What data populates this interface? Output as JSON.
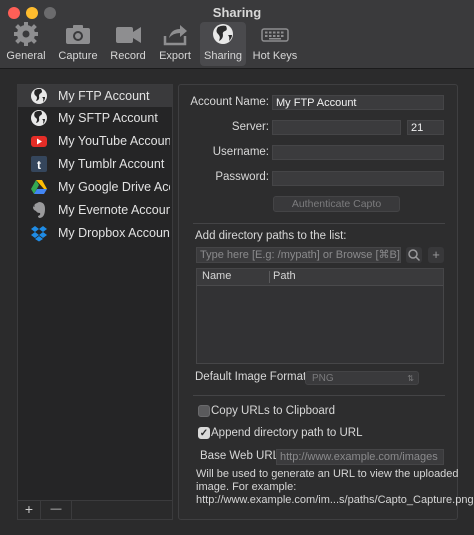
{
  "window": {
    "title": "Sharing"
  },
  "toolbar": {
    "items": [
      {
        "label": "General",
        "icon": "gear-icon"
      },
      {
        "label": "Capture",
        "icon": "camera-icon"
      },
      {
        "label": "Record",
        "icon": "video-camera-icon"
      },
      {
        "label": "Export",
        "icon": "export-arrow-icon"
      },
      {
        "label": "Sharing",
        "icon": "globe-icon",
        "active": true
      },
      {
        "label": "Hot Keys",
        "icon": "keyboard-icon"
      }
    ]
  },
  "accounts": [
    {
      "label": "My FTP Account",
      "icon": "globe-icon",
      "selected": true
    },
    {
      "label": "My SFTP Account",
      "icon": "globe-icon"
    },
    {
      "label": "My YouTube Account",
      "icon": "youtube-icon",
      "color": "#e52d27"
    },
    {
      "label": "My Tumblr Account",
      "icon": "tumblr-icon",
      "color": "#35465c"
    },
    {
      "label": "My Google Drive Account",
      "icon": "google-drive-icon"
    },
    {
      "label": "My Evernote Account",
      "icon": "evernote-icon"
    },
    {
      "label": "My Dropbox Account",
      "icon": "dropbox-icon",
      "color": "#1f8ce6"
    }
  ],
  "list_footer": {
    "add": "+",
    "remove": "—"
  },
  "form": {
    "account_name_label": "Account Name:",
    "account_name_value": "My FTP Account",
    "server_label": "Server:",
    "server_value": "",
    "port_value": "21",
    "username_label": "Username:",
    "username_value": "",
    "password_label": "Password:",
    "password_value": "",
    "authenticate_button": "Authenticate Capto"
  },
  "directories": {
    "heading": "Add directory paths to the list:",
    "input_placeholder": "Type here [E.g: /mypath] or Browse [⌘B]",
    "add_button": "+",
    "columns": [
      "Name",
      "Path"
    ]
  },
  "image_format": {
    "label": "Default Image Format:",
    "value": "PNG"
  },
  "options": {
    "copy_urls_label": "Copy URLs to Clipboard",
    "copy_urls_checked": false,
    "append_path_label": "Append directory path to URL",
    "append_path_checked": true
  },
  "base_url": {
    "label": "Base Web URL:",
    "placeholder": "http://www.example.com/images",
    "note_line1": "Will be used to generate an URL to view the uploaded",
    "note_line2": "image. For example:",
    "note_line3": "http://www.example.com/im...s/paths/Capto_Capture.png"
  }
}
